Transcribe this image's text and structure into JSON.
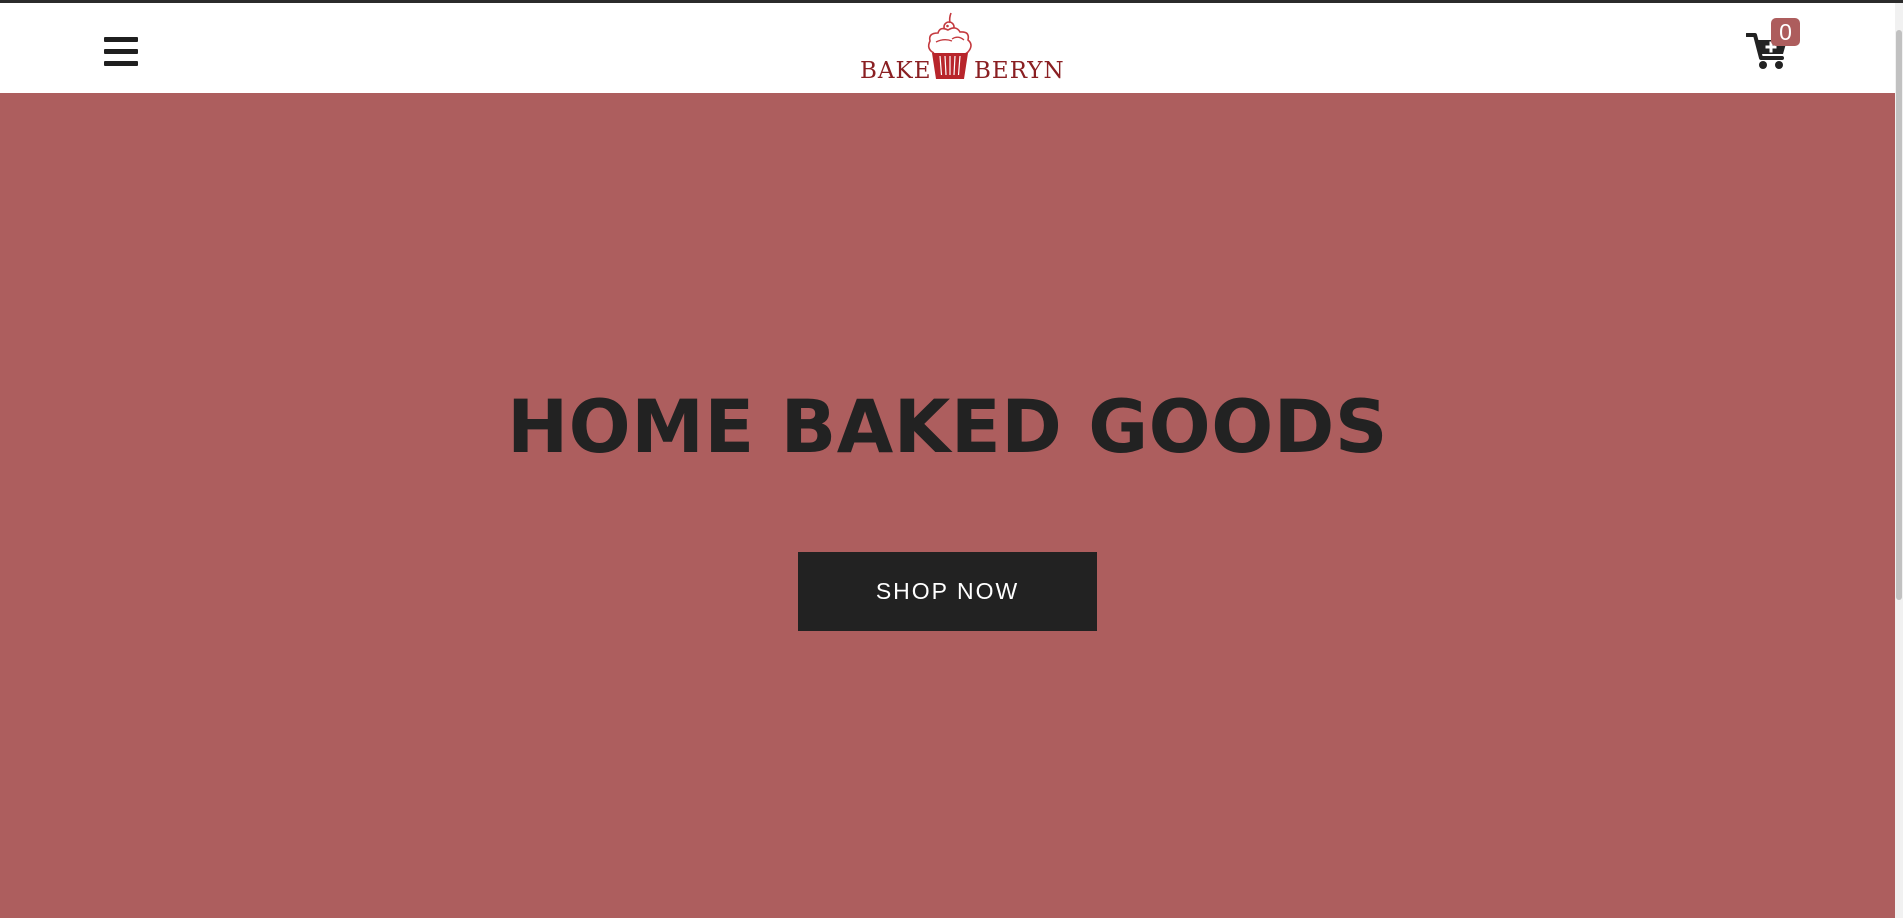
{
  "header": {
    "logo": {
      "left_word": "BAKE",
      "right_word": "BERYN"
    },
    "menu_icon": "hamburger-menu-icon",
    "cart": {
      "icon": "cart-plus-icon",
      "count": "0"
    }
  },
  "hero": {
    "title": "HOME BAKED GOODS",
    "cta_label": "SHOP NOW"
  },
  "colors": {
    "brand": "#8a1f22",
    "hero_background": "#ad5e5e",
    "button_background": "#222222",
    "badge_background": "#ad5d5d"
  }
}
